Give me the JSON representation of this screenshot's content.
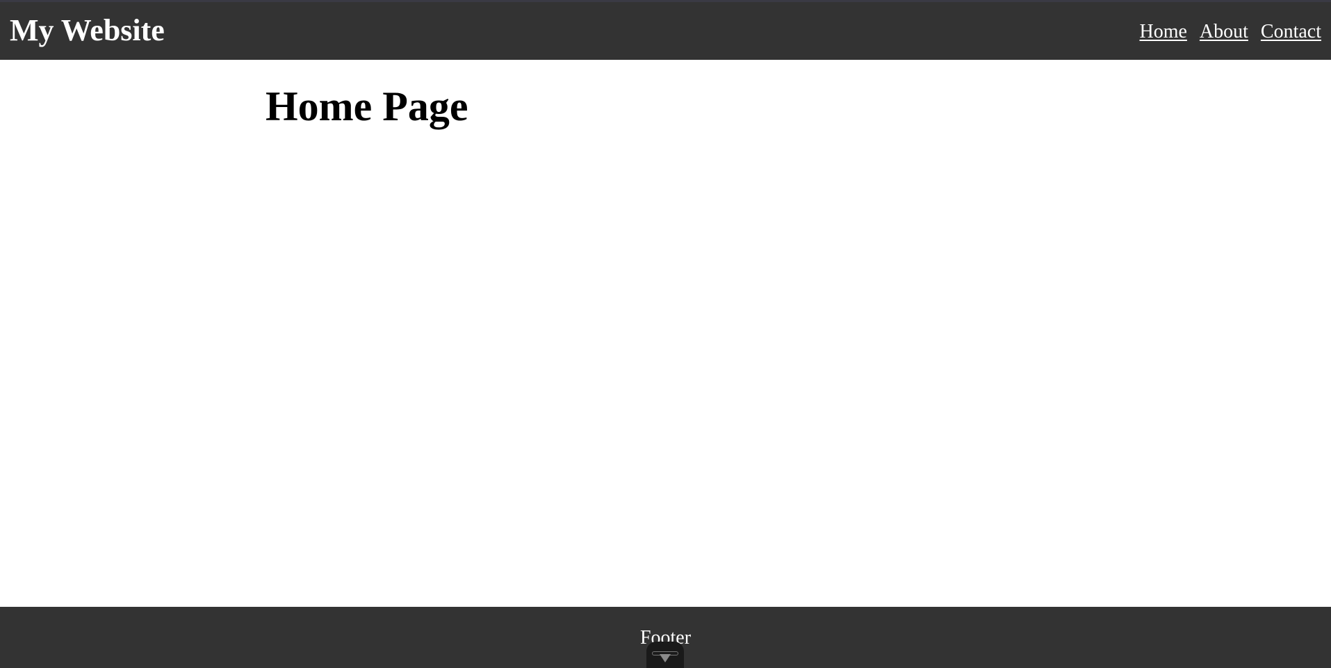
{
  "header": {
    "site_title": "My Website",
    "nav": [
      {
        "label": "Home"
      },
      {
        "label": "About"
      },
      {
        "label": "Contact"
      }
    ]
  },
  "main": {
    "heading": "Home Page"
  },
  "footer": {
    "text": "Footer",
    "handle_icon": "chevron-down-icon"
  },
  "colors": {
    "header_bg": "#333333",
    "footer_bg": "#333333",
    "page_bg": "#ffffff",
    "text_light": "#ffffff",
    "text_dark": "#000000"
  }
}
